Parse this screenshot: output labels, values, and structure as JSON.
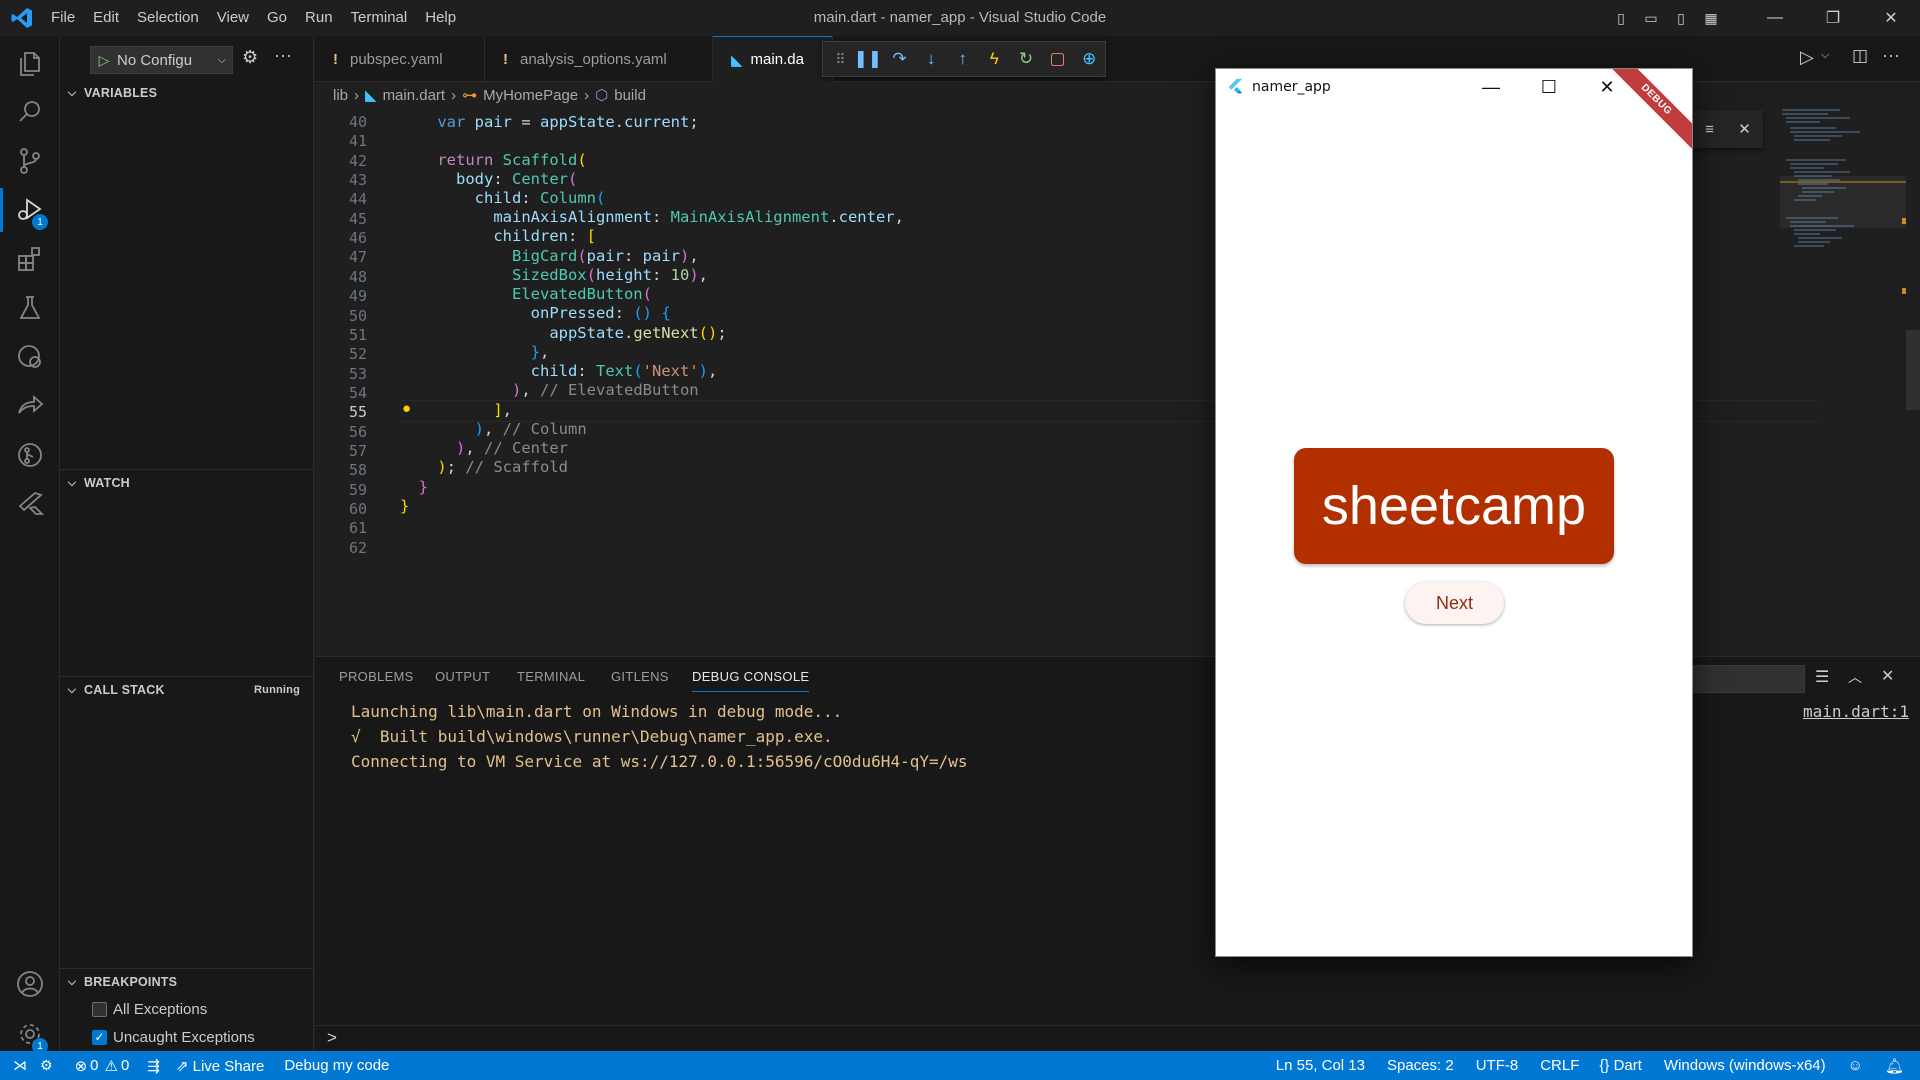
{
  "titlebar": {
    "menu": [
      "File",
      "Edit",
      "Selection",
      "View",
      "Go",
      "Run",
      "Terminal",
      "Help"
    ],
    "title": "main.dart - namer_app - Visual Studio Code"
  },
  "activity": {
    "icons": [
      "explorer-icon",
      "search-icon",
      "source-control-icon",
      "run-debug-icon",
      "extensions-icon",
      "testing-icon",
      "remote-explorer-icon",
      "live-share-icon",
      "gitlens-icon",
      "flutter-icon",
      "account-icon",
      "manage-gear-icon"
    ],
    "debug_badge": "1",
    "manage_badge": "1"
  },
  "sidebar": {
    "run_config": "No Configu",
    "variables": "VARIABLES",
    "watch": "WATCH",
    "call_stack": "CALL STACK",
    "call_stack_status": "Running",
    "breakpoints": "BREAKPOINTS",
    "bp_items": [
      {
        "label": "All Exceptions",
        "checked": false
      },
      {
        "label": "Uncaught Exceptions",
        "checked": true
      }
    ]
  },
  "tabs": [
    {
      "label": "pubspec.yaml",
      "modified": "!"
    },
    {
      "label": "analysis_options.yaml",
      "modified": "!"
    },
    {
      "label": "main.da",
      "active": true
    }
  ],
  "breadcrumb": [
    "lib",
    "main.dart",
    "MyHomePage",
    "build"
  ],
  "editor": {
    "lines": [
      "40",
      "41",
      "42",
      "43",
      "44",
      "45",
      "46",
      "47",
      "48",
      "49",
      "50",
      "51",
      "52",
      "53",
      "54",
      "55",
      "56",
      "57",
      "58",
      "59",
      "60",
      "61",
      "62"
    ],
    "current_line": "55"
  },
  "panel": {
    "tabs": [
      "PROBLEMS",
      "OUTPUT",
      "TERMINAL",
      "GITLENS",
      "DEBUG CONSOLE"
    ],
    "active_tab": "DEBUG CONSOLE",
    "console": [
      "Launching lib\\main.dart on Windows in debug mode...",
      "√  Built build\\windows\\runner\\Debug\\namer_app.exe.",
      "Connecting to VM Service at ws://127.0.0.1:56596/cO0du6H4-qY=/ws"
    ],
    "source_link": "main.dart:1",
    "prompt": ">"
  },
  "app": {
    "title": "namer_app",
    "card_text": "sheetcamp",
    "button_label": "Next",
    "debug_banner": "DEBUG",
    "card_color": "#b23000"
  },
  "statusbar": {
    "errors": "0",
    "warnings": "0",
    "live_share": "Live Share",
    "debug_label": "Debug my code",
    "cursor": "Ln 55, Col 13",
    "spaces": "Spaces: 2",
    "encoding": "UTF-8",
    "eol": "CRLF",
    "language": "Dart",
    "device": "Windows (windows-x64)"
  },
  "colors": {
    "accent": "#0078d4",
    "statusbar": "#0078d4"
  }
}
